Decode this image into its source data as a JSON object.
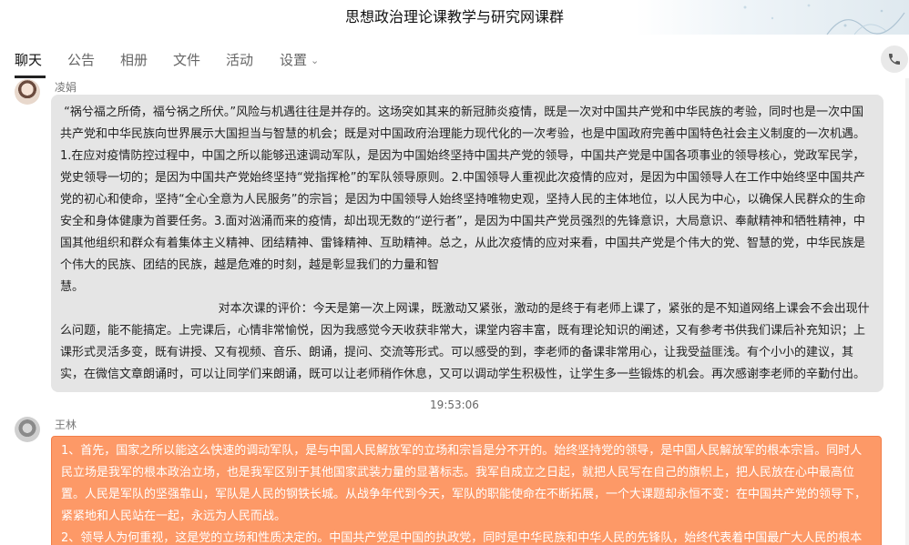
{
  "window": {
    "title": "思想政治理论课教学与研究网课群"
  },
  "tabs": [
    {
      "label": "聊天"
    },
    {
      "label": "公告"
    },
    {
      "label": "相册"
    },
    {
      "label": "文件"
    },
    {
      "label": "活动"
    },
    {
      "label": "设置"
    }
  ],
  "messages": [
    {
      "sender": "凌娟",
      "text": " “祸兮福之所倚，福兮祸之所伏。”风险与机遇往往是并存的。这场突如其来的新冠肺炎疫情，既是一次对中国共产党和中华民族的考验，同时也是一次中国共产党和中华民族向世界展示大国担当与智慧的机会；既是对中国政府治理能力现代化的一次考验，也是中国政府完善中国特色社会主义制度的一次机遇。1.在应对疫情防控过程中，中国之所以能够迅速调动军队，是因为中国始终坚持中国共产党的领导，中国共产党是中国各项事业的领导核心，党政军民学，党史领导一切的；是因为中国共产党始终坚持“党指挥枪”的军队领导原则。2.中国领导人重视此次疫情的应对，是因为中国领导人在工作中始终坚中国共产党的初心和使命，坚持“全心全意为人民服务”的宗旨；是因为中国领导人始终坚持唯物史观，坚持人民的主体地位，以人民为中心，以确保人民群众的生命安全和身体健康为首要任务。3.面对汹涌而来的疫情，却出现无数的“逆行者”，是因为中国共产党员强烈的先锋意识，大局意识、奉献精神和牺牲精神，中国其他组织和群众有着集体主义精神、团结精神、雷锋精神、互助精神。总之，从此次疫情的应对来看，中国共产党是个伟大的党、智慧的党，中华民族是个伟大的民族、团结的民族，越是危难的时刻，越是彰显我们的力量和智\n慧。\n                                          对本次课的评价：今天是第一次上网课，既激动又紧张，激动的是终于有老师上课了，紧张的是不知道网络上课会不会出现什么问题，能不能搞定。上完课后，心情非常愉悦，因为我感觉今天收获非常大，课堂内容丰富，既有理论知识的阐述，又有参考书供我们课后补充知识；上课形式灵活多变，既有讲授、又有视频、音乐、朗诵，提问、交流等形式。可以感受的到，李老师的备课非常用心，让我受益匪浅。有个小小的建议，其实，在微信文章朗诵时，可以让同学们来朗诵，既可以让老师稍作休息，又可以调动学生积极性，让学生多一些锻炼的机会。再次感谢李老师的辛勤付出。"
    },
    {
      "sender": "王林",
      "text": "1、首先，国家之所以能这么快速的调动军队，是与中国人民解放军的立场和宗旨是分不开的。始终坚持党的领导，是中国人民解放军的根本宗旨。同时人民立场是我军的根本政治立场，也是我军区别于其他国家武装力量的显著标志。我军自成立之日起，就把人民写在自己的旗帜上，把人民放在心中最高位置。人民是军队的坚强靠山，军队是人民的钢铁长城。从战争年代到今天，军队的职能使命在不断拓展，一个大课题却永恒不变：在中国共产党的领导下，紧紧地和人民站在一起，永远为人民而战。\n2、领导人为何重视，这是党的立场和性质决定的。中国共产党是中国的执政党，同时是中华民族和中华人民的先锋队，始终代表着中国最广大人民的根本利益"
    }
  ],
  "timestamp": "19:53:06",
  "colors": {
    "incoming_bubble": "#e5e5e5",
    "highlight_bubble": "#fd9967"
  }
}
